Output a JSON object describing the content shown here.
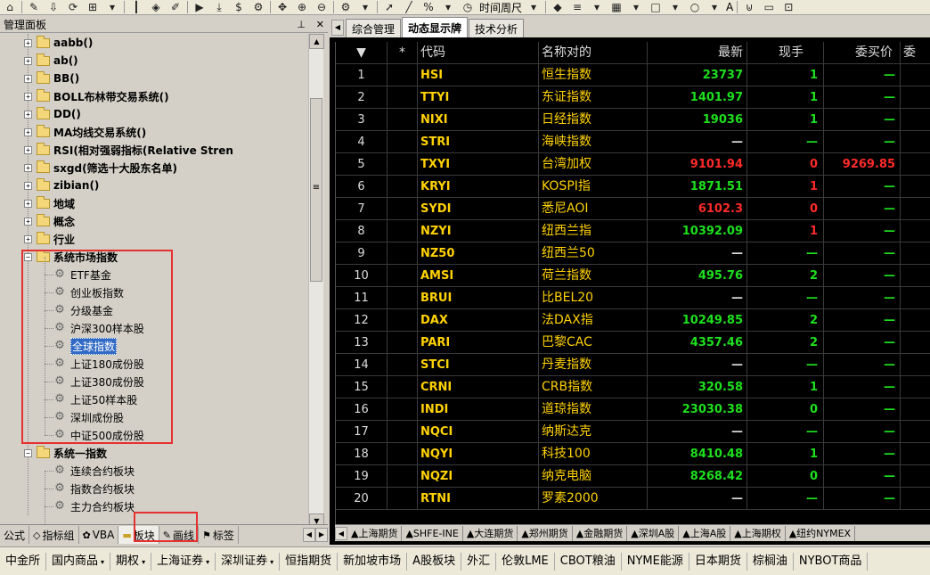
{
  "toolbar": {
    "time_period_label": "时间周尺",
    "letter_a_label": "A"
  },
  "left_panel": {
    "title": "管理面板",
    "pin_icon": "pin-icon",
    "close_icon": "close-icon",
    "tree": [
      {
        "label": "aabb()",
        "type": "folder",
        "expanded": false
      },
      {
        "label": "ab()",
        "type": "folder",
        "expanded": false
      },
      {
        "label": "BB()",
        "type": "folder",
        "expanded": false
      },
      {
        "label": "BOLL布林带交易系统()",
        "type": "folder",
        "expanded": false
      },
      {
        "label": "DD()",
        "type": "folder",
        "expanded": false
      },
      {
        "label": "MA均线交易系统()",
        "type": "folder",
        "expanded": false
      },
      {
        "label": "RSI(相对强弱指标(Relative Stren",
        "type": "folder",
        "expanded": false
      },
      {
        "label": "sxgd(筛选十大股东名单)",
        "type": "folder",
        "expanded": false
      },
      {
        "label": "zibian()",
        "type": "folder",
        "expanded": false
      },
      {
        "label": "地域",
        "type": "folder",
        "expanded": false
      },
      {
        "label": "概念",
        "type": "folder",
        "expanded": false
      },
      {
        "label": "行业",
        "type": "folder",
        "expanded": false
      },
      {
        "label": "系统市场指数",
        "type": "folder",
        "expanded": true
      },
      {
        "label": "ETF基金",
        "type": "leaf"
      },
      {
        "label": "创业板指数",
        "type": "leaf"
      },
      {
        "label": "分级基金",
        "type": "leaf"
      },
      {
        "label": "沪深300样本股",
        "type": "leaf"
      },
      {
        "label": "全球指数",
        "type": "leaf",
        "selected": true
      },
      {
        "label": "上证180成份股",
        "type": "leaf"
      },
      {
        "label": "上证380成份股",
        "type": "leaf"
      },
      {
        "label": "上证50样本股",
        "type": "leaf"
      },
      {
        "label": "深圳成份股",
        "type": "leaf"
      },
      {
        "label": "中证500成份股",
        "type": "leaf"
      },
      {
        "label": "系统一指数",
        "type": "folder",
        "expanded": true
      },
      {
        "label": "连续合约板块",
        "type": "leaf"
      },
      {
        "label": "指数合约板块",
        "type": "leaf"
      },
      {
        "label": "主力合约板块",
        "type": "leaf"
      }
    ],
    "tabs": [
      "公式",
      "指标组",
      "VBA",
      "板块",
      "画线",
      "标签"
    ],
    "active_tab": "板块"
  },
  "right_panel": {
    "tabs": [
      "综合管理",
      "动态显示牌",
      "技术分析"
    ],
    "active_tab": "动态显示牌",
    "columns": [
      "▼",
      "*",
      "代码",
      "名称对的",
      "最新",
      "现手",
      "委买价",
      "委"
    ],
    "rows": [
      {
        "no": "1",
        "code": "HSI",
        "name": "恒生指数",
        "last": "23737",
        "last_color": "g",
        "vol": "1",
        "vol_color": "g",
        "bid": "—",
        "bid_color": "g"
      },
      {
        "no": "2",
        "code": "TTYI",
        "name": "东证指数",
        "last": "1401.97",
        "last_color": "g",
        "vol": "1",
        "vol_color": "g",
        "bid": "—",
        "bid_color": "g"
      },
      {
        "no": "3",
        "code": "NIXI",
        "name": "日经指数",
        "last": "19036",
        "last_color": "g",
        "vol": "1",
        "vol_color": "g",
        "bid": "—",
        "bid_color": "g"
      },
      {
        "no": "4",
        "code": "STRI",
        "name": "海峡指数",
        "last": "—",
        "last_color": "w",
        "vol": "—",
        "vol_color": "g",
        "bid": "—",
        "bid_color": "g"
      },
      {
        "no": "5",
        "code": "TXYI",
        "name": "台湾加权",
        "last": "9101.94",
        "last_color": "r",
        "vol": "0",
        "vol_color": "r",
        "bid": "9269.85",
        "bid_color": "r"
      },
      {
        "no": "6",
        "code": "KRYI",
        "name": "KOSPI指",
        "last": "1871.51",
        "last_color": "g",
        "vol": "1",
        "vol_color": "r",
        "bid": "—",
        "bid_color": "g"
      },
      {
        "no": "7",
        "code": "SYDI",
        "name": "悉尼AOI",
        "last": "6102.3",
        "last_color": "r",
        "vol": "0",
        "vol_color": "r",
        "bid": "—",
        "bid_color": "g"
      },
      {
        "no": "8",
        "code": "NZYI",
        "name": "纽西兰指",
        "last": "10392.09",
        "last_color": "g",
        "vol": "1",
        "vol_color": "r",
        "bid": "—",
        "bid_color": "g"
      },
      {
        "no": "9",
        "code": "NZ50",
        "name": "纽西兰50",
        "last": "—",
        "last_color": "w",
        "vol": "—",
        "vol_color": "g",
        "bid": "—",
        "bid_color": "g"
      },
      {
        "no": "10",
        "code": "AMSI",
        "name": "荷兰指数",
        "last": "495.76",
        "last_color": "g",
        "vol": "2",
        "vol_color": "g",
        "bid": "—",
        "bid_color": "g"
      },
      {
        "no": "11",
        "code": "BRUI",
        "name": "比BEL20",
        "last": "—",
        "last_color": "w",
        "vol": "—",
        "vol_color": "g",
        "bid": "—",
        "bid_color": "g"
      },
      {
        "no": "12",
        "code": "DAX",
        "name": "法DAX指",
        "last": "10249.85",
        "last_color": "g",
        "vol": "2",
        "vol_color": "g",
        "bid": "—",
        "bid_color": "g"
      },
      {
        "no": "13",
        "code": "PARI",
        "name": "巴黎CAC",
        "last": "4357.46",
        "last_color": "g",
        "vol": "2",
        "vol_color": "g",
        "bid": "—",
        "bid_color": "g"
      },
      {
        "no": "14",
        "code": "STCI",
        "name": "丹麦指数",
        "last": "—",
        "last_color": "w",
        "vol": "—",
        "vol_color": "g",
        "bid": "—",
        "bid_color": "g"
      },
      {
        "no": "15",
        "code": "CRNI",
        "name": "CRB指数",
        "last": "320.58",
        "last_color": "g",
        "vol": "1",
        "vol_color": "g",
        "bid": "—",
        "bid_color": "g"
      },
      {
        "no": "16",
        "code": "INDI",
        "name": "道琼指数",
        "last": "23030.38",
        "last_color": "g",
        "vol": "0",
        "vol_color": "g",
        "bid": "—",
        "bid_color": "g"
      },
      {
        "no": "17",
        "code": "NQCI",
        "name": "纳斯达克",
        "last": "—",
        "last_color": "w",
        "vol": "—",
        "vol_color": "g",
        "bid": "—",
        "bid_color": "g"
      },
      {
        "no": "18",
        "code": "NQYI",
        "name": "科技100",
        "last": "8410.48",
        "last_color": "g",
        "vol": "1",
        "vol_color": "g",
        "bid": "—",
        "bid_color": "g"
      },
      {
        "no": "19",
        "code": "NQZI",
        "name": "纳克电脑",
        "last": "8268.42",
        "last_color": "g",
        "vol": "0",
        "vol_color": "g",
        "bid": "—",
        "bid_color": "g"
      },
      {
        "no": "20",
        "code": "RTNI",
        "name": "罗素2000",
        "last": "—",
        "last_color": "w",
        "vol": "—",
        "vol_color": "g",
        "bid": "—",
        "bid_color": "g"
      }
    ],
    "sheet_tabs": [
      "▲上海期货",
      "▲SHFE-INE",
      "▲大连期货",
      "▲郑州期货",
      "▲金融期货",
      "▲深圳A股",
      "▲上海A股",
      "▲上海期权",
      "▲纽约NYMEX"
    ]
  },
  "market_bar": [
    {
      "label": "中金所",
      "dropdown": false
    },
    {
      "label": "国内商品",
      "dropdown": true
    },
    {
      "label": "期权",
      "dropdown": true
    },
    {
      "label": "上海证券",
      "dropdown": true
    },
    {
      "label": "深圳证券",
      "dropdown": true
    },
    {
      "label": "恒指期货",
      "dropdown": false
    },
    {
      "label": "新加坡市场",
      "dropdown": false
    },
    {
      "label": "A股板块",
      "dropdown": false
    },
    {
      "label": "外汇",
      "dropdown": false
    },
    {
      "label": "伦敦LME",
      "dropdown": false
    },
    {
      "label": "CBOT粮油",
      "dropdown": false
    },
    {
      "label": "NYME能源",
      "dropdown": false
    },
    {
      "label": "日本期货",
      "dropdown": false
    },
    {
      "label": "棕榈油",
      "dropdown": false
    },
    {
      "label": "NYBOT商品",
      "dropdown": false
    }
  ]
}
